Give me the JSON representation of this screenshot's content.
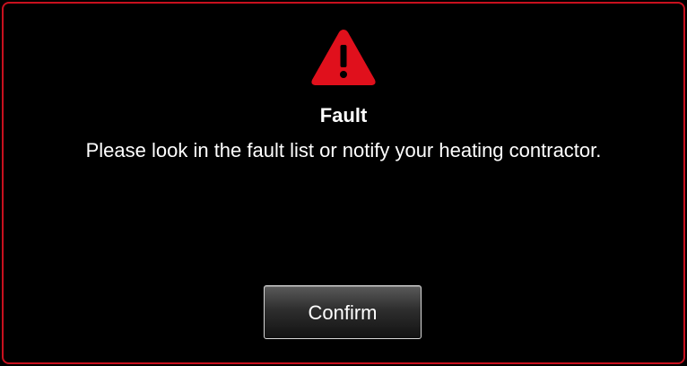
{
  "dialog": {
    "icon": "warning-triangle-icon",
    "title": "Fault",
    "message": "Please look in the fault list or notify your heating contractor.",
    "confirm_label": "Confirm"
  },
  "colors": {
    "accent": "#c8101e",
    "background": "#000000",
    "text": "#ffffff"
  }
}
